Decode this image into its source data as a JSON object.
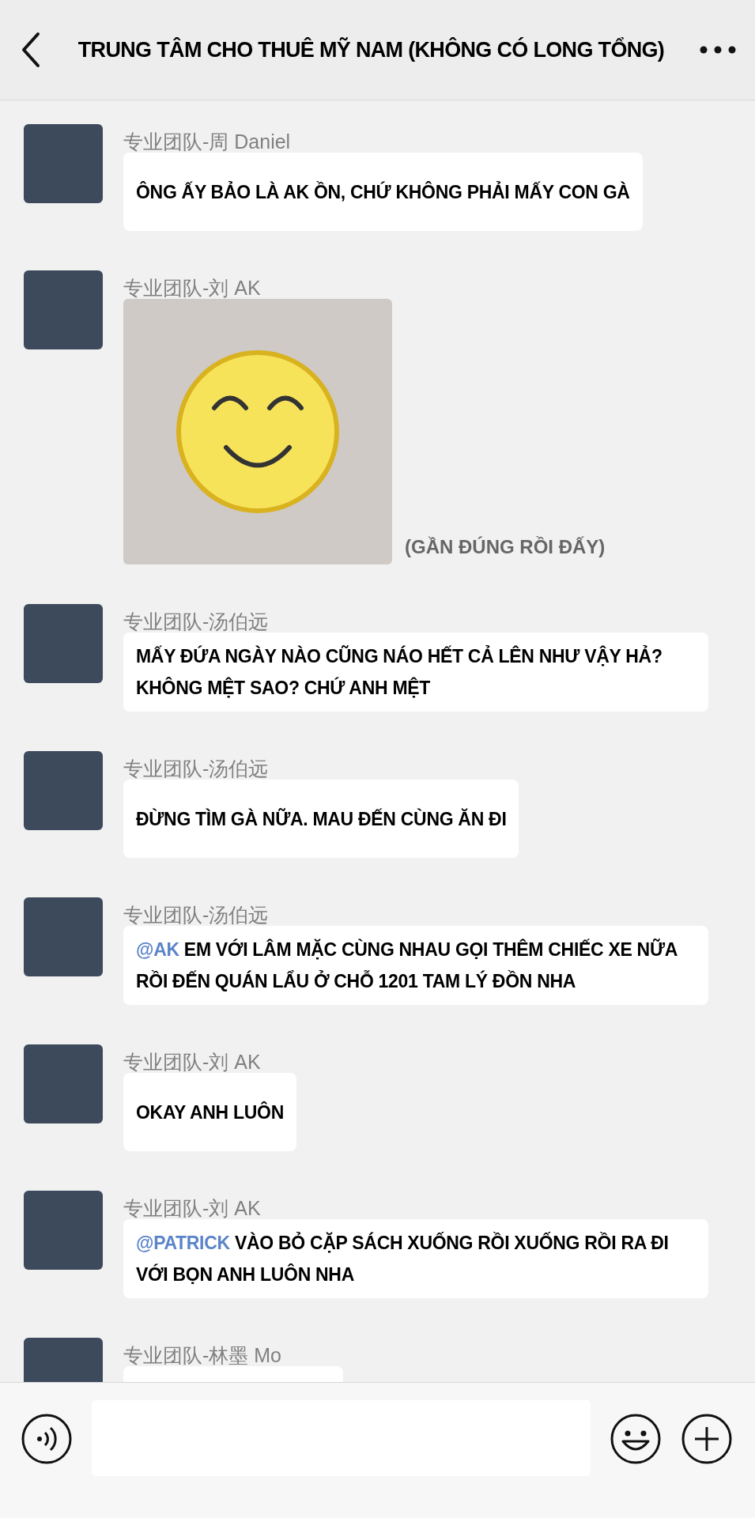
{
  "header": {
    "title": "TRUNG TÂM CHO THUÊ MỸ NAM (KHÔNG CÓ LONG TỔNG)"
  },
  "messages": [
    {
      "sender": "专业团队-周 Daniel",
      "kind": "text",
      "text": "ÔNG ẤY BẢO LÀ AK ỒN, CHỨ KHÔNG PHẢI MẤY CON GÀ"
    },
    {
      "sender": "专业团队-刘 AK",
      "kind": "image",
      "caption": "(GẦN ĐÚNG RỒI ĐẤY)"
    },
    {
      "sender": "专业团队-汤伯远",
      "kind": "text",
      "text": "MẤY ĐỨA NGÀY NÀO CŨNG NÁO HẾT CẢ LÊN NHƯ VẬY HẢ? KHÔNG MỆT SAO? CHỨ ANH MỆT"
    },
    {
      "sender": "专业团队-汤伯远",
      "kind": "text",
      "text": "ĐỪNG TÌM GÀ NỮA. MAU ĐẾN CÙNG ĂN ĐI"
    },
    {
      "sender": "专业团队-汤伯远",
      "kind": "text",
      "mention": "@AK",
      "text": "EM VỚI LÂM MẶC CÙNG NHAU GỌI THÊM CHIẾC XE NỮA RỒI ĐẾN QUÁN LẨU Ở CHỖ 1201 TAM LÝ ĐỒN NHA"
    },
    {
      "sender": "专业团队-刘 AK",
      "kind": "text",
      "text": "OKAY ANH LUÔN"
    },
    {
      "sender": "专业团队-刘 AK",
      "kind": "text",
      "mention": "@PATRICK",
      "text": "VÀO BỎ CẶP SÁCH XUỐNG RỒI XUỐNG RỒI RA ĐI VỚI BỌN ANH LUÔN NHA"
    },
    {
      "sender": "专业团队-林墨 Mo",
      "kind": "cut_off"
    }
  ]
}
